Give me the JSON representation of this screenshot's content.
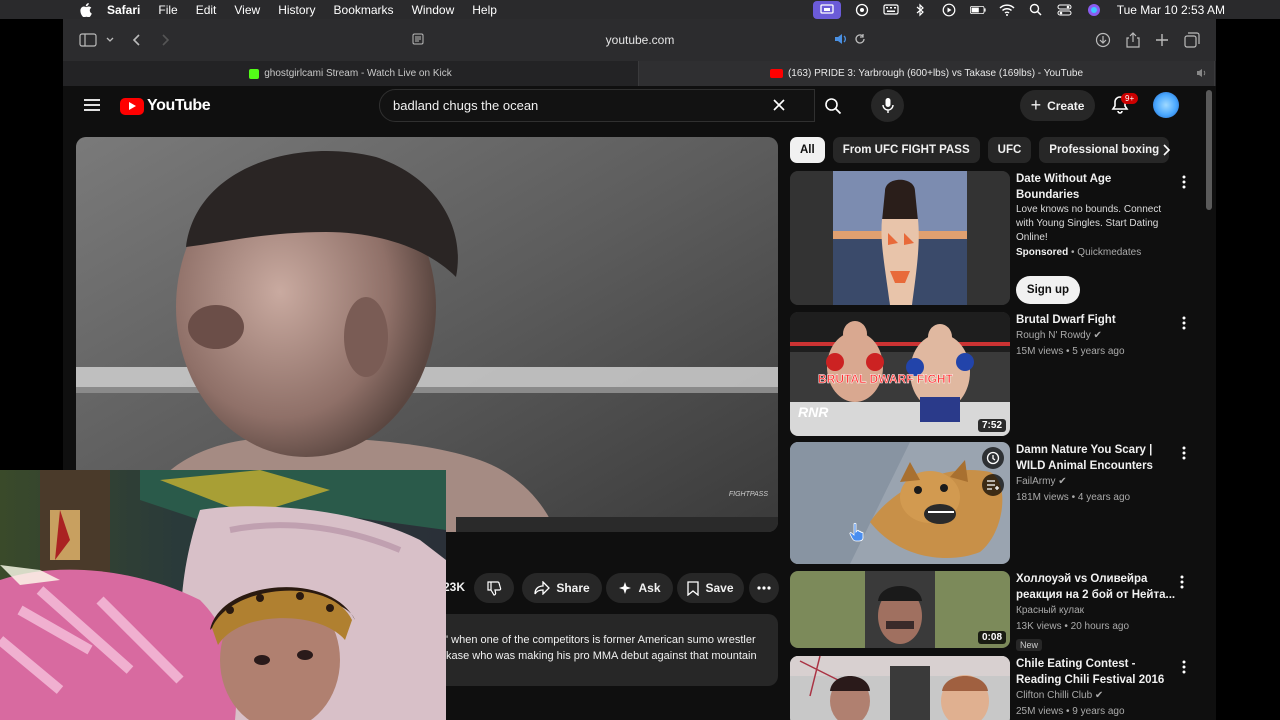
{
  "menubar": {
    "app": "Safari",
    "items": [
      "File",
      "Edit",
      "View",
      "History",
      "Bookmarks",
      "Window",
      "Help"
    ],
    "clock": "Tue Mar 10  2:53 AM"
  },
  "safari": {
    "url": "youtube.com",
    "tabs": [
      {
        "title": "ghostgirlcami Stream - Watch Live on Kick",
        "fav_color": "#53fc18"
      },
      {
        "title": "(163) PRIDE 3: Yarbrough (600+lbs) vs Takase (169lbs) - YouTube",
        "fav_color": "#ff0000"
      }
    ]
  },
  "youtube": {
    "logo_text": "YouTube",
    "search_value": "badland chugs the ocean",
    "create_label": "Create",
    "notif_badge": "9+",
    "like_count": "23K",
    "share_label": "Share",
    "ask_label": "Ask",
    "save_label": "Save",
    "watermark": "FIGHTPASS",
    "description_lines": [
      "' when one of the competitors is former American sumo wrestler",
      "kase who was making his pro MMA debut against that mountain"
    ],
    "chips": [
      "All",
      "From UFC FIGHT PASS",
      "UFC",
      "Professional boxing"
    ],
    "recommendations": [
      {
        "title": "Date Without Age Boundaries",
        "desc": "Love knows no bounds. Connect with Young Singles. Start Dating Online!",
        "sponsored": "Sponsored",
        "advertiser": "Quickmedates",
        "cta": "Sign up"
      },
      {
        "title": "Brutal Dwarf Fight",
        "channel": "Rough N' Rowdy",
        "meta": "15M views • 5 years ago",
        "duration": "7:52",
        "thumb_text": "BRUTAL DWARF FIGHT",
        "thumb_logo": "RNR"
      },
      {
        "title": "Damn Nature You Scary | WILD Animal Encounters",
        "channel": "FailArmy",
        "meta": "181M views • 4 years ago"
      },
      {
        "title": "Холлоуэй vs Оливейра реакция на 2 бой от Нейта...",
        "channel": "Красный кулак",
        "meta": "13K views • 20 hours ago",
        "duration": "0:08",
        "badge": "New"
      },
      {
        "title": "Chile Eating Contest - Reading Chili Festival 2016",
        "channel": "Clifton Chilli Club",
        "meta": "25M views • 9 years ago"
      }
    ]
  }
}
